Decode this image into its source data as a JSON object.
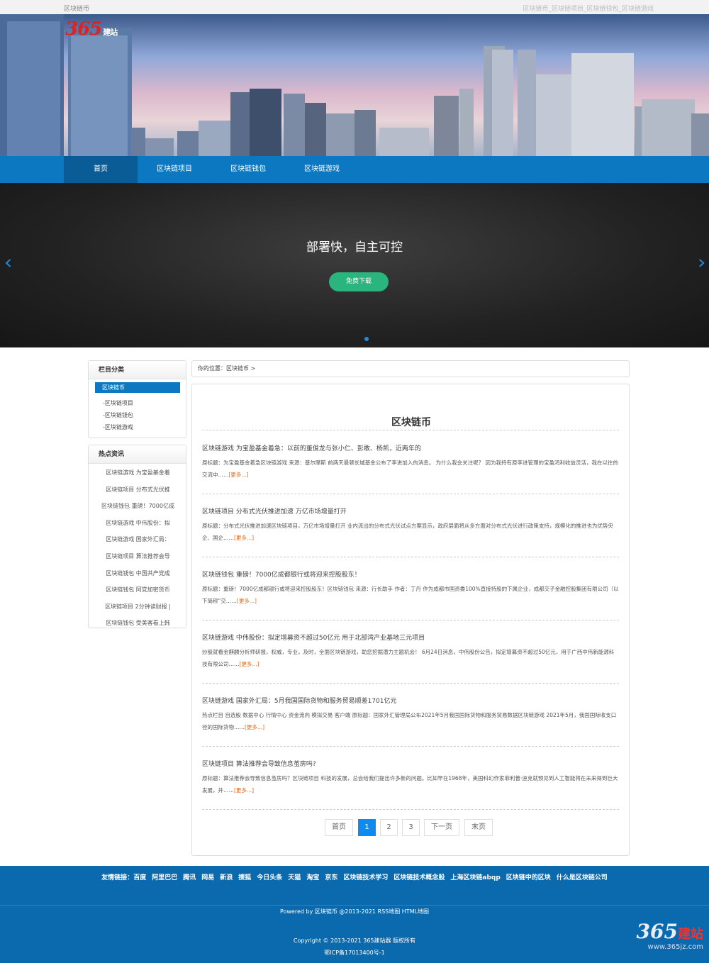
{
  "topbar": {
    "left": "区块链币",
    "right": "区块链币_区块链项目_区块链钱包_区块链游戏"
  },
  "logo": {
    "num": "365",
    "text": "建站"
  },
  "nav": {
    "items": [
      {
        "label": "首页"
      },
      {
        "label": "区块链项目"
      },
      {
        "label": "区块链钱包"
      },
      {
        "label": "区块链游戏"
      }
    ]
  },
  "slider": {
    "heading": "部署快，自主可控",
    "button": "免费下载",
    "prev": "‹",
    "next": "›"
  },
  "sidebar": {
    "cat_title": "栏目分类",
    "active": "区块链币",
    "cats": [
      "-区块链项目",
      "-区块链钱包",
      "-区块链游戏"
    ],
    "hot_title": "热点资讯",
    "hot": [
      "区块链游戏 为宝盈基金着",
      "区块链项目 分布式光伏推",
      "区块链钱包 重磅！7000亿成",
      "区块链游戏 中伟股份：拟",
      "区块链游戏 国家外汇局：",
      "区块链项目 算法推荐会导",
      "区块链钱包 中国共产党成",
      "区块链钱包 阿党加密货币",
      "区块链项目 2分钟读财报 |",
      "区块链钱包 受美客看上韩"
    ]
  },
  "crumb": "你的位置：区块链币 >",
  "main": {
    "title": "区块链币",
    "more": "[更多...]",
    "articles": [
      {
        "title": "区块链游戏 为宝盈基金着急：以前的董俊龙与张小仁、彭敢、杨凯，近两年的",
        "desc": "原标题：为宝盈基金着急区块链游戏 来源：基尔摩斯 前两天曼顿长城基金公布了李进加入的消息。 为什么我会关注呢？ 因为我持有原李进管理的宝盈鸿利收益灵活，我在以往的交流中……"
      },
      {
        "title": "区块链项目 分布式光伏推进加速 万亿市场增量打开",
        "desc": "原标题：分布式光伏推进加速区块链项目，万亿市场增量打开 业内流出的分布式光伏试点方案显示，政府层面将从多方面对分布式光伏进行政策支持，规模化的推进也为优势央企、国企……"
      },
      {
        "title": "区块链钱包 重磅！7000亿成都银行或将迎来控股股东！",
        "desc": "原标题：重磅！7000亿成都银行或将迎来控股股东！区块链钱包 来源：行长助手 作者：丁丹 作为成都市国资委100%直接持股的下属企业，成都交子金融控股集团有限公司（以下简称“交……"
      },
      {
        "title": "区块链游戏 中伟股份：拟定增募资不超过50亿元 用于北部湾产业基地三元项目",
        "desc": "炒股就看金麒麟分析师研报，权威，专业，及时，全面区块链游戏，助您挖掘潜力主题机会！ 6月24日消息，中伟股份公告，拟定增募资不超过50亿元，用于广西中伟新能源科技有限公司……"
      },
      {
        "title": "区块链游戏 国家外汇局：5月我国国际货物和服务贸易顺差1701亿元",
        "desc": "热点栏目 自选股 数据中心 行情中心 资金流向 模拟交易 客户端 原标题：国家外汇管理局公布2021年5月我国国际货物和服务贸易数据区块链游戏 2021年5月，我国国际收支口径的国际货物……"
      },
      {
        "title": "区块链项目 算法推荐会导致信息茧房吗?",
        "desc": "原标题：算法推荐会导致信息茧房吗？区块链项目 科技的发展，总会给我们提出许多新的问题。比如早在1968年，美国科幻作家菲利普·迪克就预见到人工智能将在未来得到巨大发展，并……"
      }
    ]
  },
  "pagination": {
    "first": "首页",
    "p1": "1",
    "p2": "2",
    "p3": "3",
    "next": "下一页",
    "last": "末页"
  },
  "footer": {
    "links_label": "友情链接：",
    "links": [
      "百度",
      "阿里巴巴",
      "腾讯",
      "网易",
      "新浪",
      "搜狐",
      "今日头条",
      "天猫",
      "淘宝",
      "京东",
      "区块链技术学习",
      "区块链技术概念股",
      "上海区块链abqp",
      "区块链中的区块",
      "什么是区块链公司"
    ],
    "powered": "Powered by 区块链币 @2013-2021 RSS地图 HTML地图",
    "copyright": "Copyright © 2013-2021 365建站器 版权所有",
    "icp": "鄂ICP备17013400号-1",
    "wm_num": "365",
    "wm_text": "建站",
    "wm_url": "www.365jz.com"
  },
  "colors": {
    "nav": "#0d78c2",
    "footer": "#0b69ad",
    "button": "#2bb57e",
    "accent": "#e26a1a",
    "page_active": "#0d8bf0"
  }
}
